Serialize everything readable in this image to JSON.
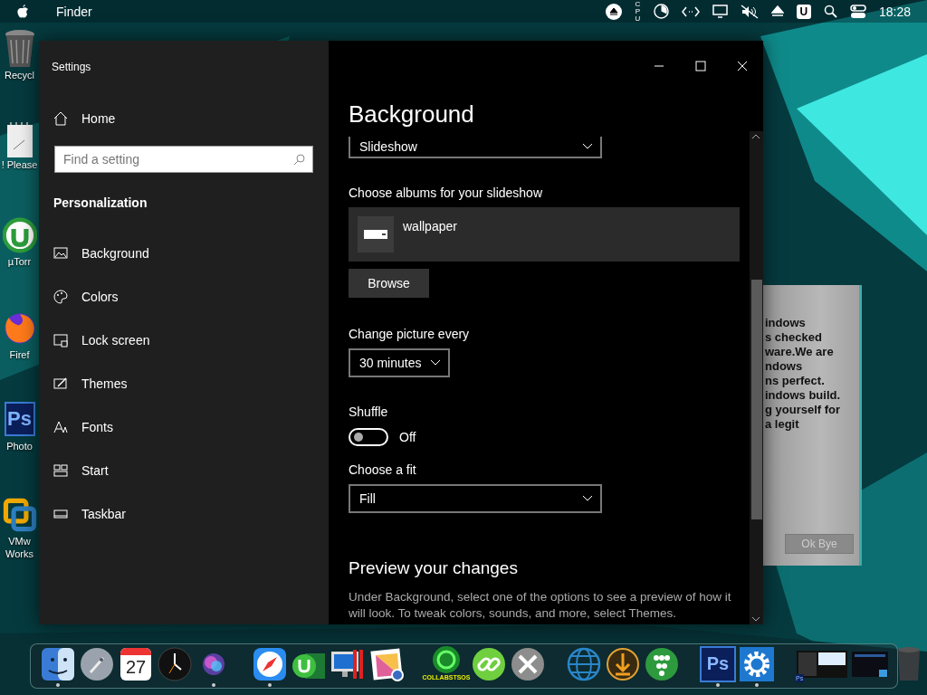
{
  "menu_bar": {
    "app": "Finder",
    "cpu_label": "CPU",
    "user_badge": "U",
    "time": "18:28"
  },
  "desktop_icons": [
    {
      "kind": "trash",
      "lines": [
        "Recycl"
      ]
    },
    {
      "kind": "note",
      "lines": [
        "! Please"
      ]
    },
    {
      "kind": "utorrent",
      "lines": [
        "µTorr"
      ]
    },
    {
      "kind": "firefox",
      "lines": [
        "Firef"
      ]
    },
    {
      "kind": "photoshop",
      "glyph": "Ps",
      "lines": [
        "Photo"
      ]
    },
    {
      "kind": "vmware",
      "lines": [
        "VMw",
        "Works"
      ]
    }
  ],
  "behind_dialog": {
    "lines": [
      "indows",
      "s checked",
      "ware.We are",
      "ndows",
      "ns perfect.",
      "indows build.",
      "g yourself for",
      "a legit"
    ],
    "button": "Ok Bye"
  },
  "settings": {
    "title": "Settings",
    "nav": {
      "home": "Home",
      "search_placeholder": "Find a setting",
      "section": "Personalization",
      "items": [
        {
          "kind": "picture",
          "label": "Background"
        },
        {
          "kind": "palette",
          "label": "Colors"
        },
        {
          "kind": "lockscreen",
          "label": "Lock screen"
        },
        {
          "kind": "brush",
          "label": "Themes"
        },
        {
          "kind": "fonts",
          "label": "Fonts"
        },
        {
          "kind": "start",
          "label": "Start"
        },
        {
          "kind": "taskbar",
          "label": "Taskbar"
        }
      ]
    },
    "page": {
      "title": "Background",
      "background_dropdown": "Slideshow",
      "albums_label": "Choose albums for your slideshow",
      "album": "wallpaper",
      "browse": "Browse",
      "interval_label": "Change picture every",
      "interval": "30 minutes",
      "shuffle_label": "Shuffle",
      "shuffle": {
        "on": false,
        "state_text": "Off"
      },
      "fit_label": "Choose a fit",
      "fit": "Fill",
      "preview_heading": "Preview your changes",
      "preview_text": "Under Background, select one of the options to see a preview of how it will look. To tweak colors, sounds, and more, select Themes."
    }
  },
  "dock": {
    "items": [
      {
        "kind": "finder",
        "running": true
      },
      {
        "kind": "launchpad",
        "running": false
      },
      {
        "kind": "calendar",
        "text": "27",
        "running": false
      },
      {
        "kind": "clock",
        "running": false
      },
      {
        "kind": "siri",
        "running": true
      },
      {
        "kind": "separator"
      },
      {
        "kind": "safari",
        "running": true
      },
      {
        "kind": "utorrent",
        "running": false
      },
      {
        "kind": "bootcamp",
        "running": false
      },
      {
        "kind": "photos",
        "running": false
      },
      {
        "kind": "separator"
      },
      {
        "kind": "collab",
        "text": "COLLABSTSOS",
        "running": false
      },
      {
        "kind": "link",
        "running": false
      },
      {
        "kind": "tools",
        "running": false
      },
      {
        "kind": "separator"
      },
      {
        "kind": "www",
        "running": false
      },
      {
        "kind": "download",
        "running": false
      },
      {
        "kind": "people",
        "running": false
      },
      {
        "kind": "separator"
      },
      {
        "kind": "photoshop",
        "text": "Ps",
        "running": true
      },
      {
        "kind": "gear",
        "running": true
      },
      {
        "kind": "separator"
      },
      {
        "kind": "window-thumb",
        "text": "Ps",
        "running": false
      },
      {
        "kind": "window-thumb2",
        "running": false
      },
      {
        "kind": "dock-trash",
        "running": false
      }
    ]
  }
}
